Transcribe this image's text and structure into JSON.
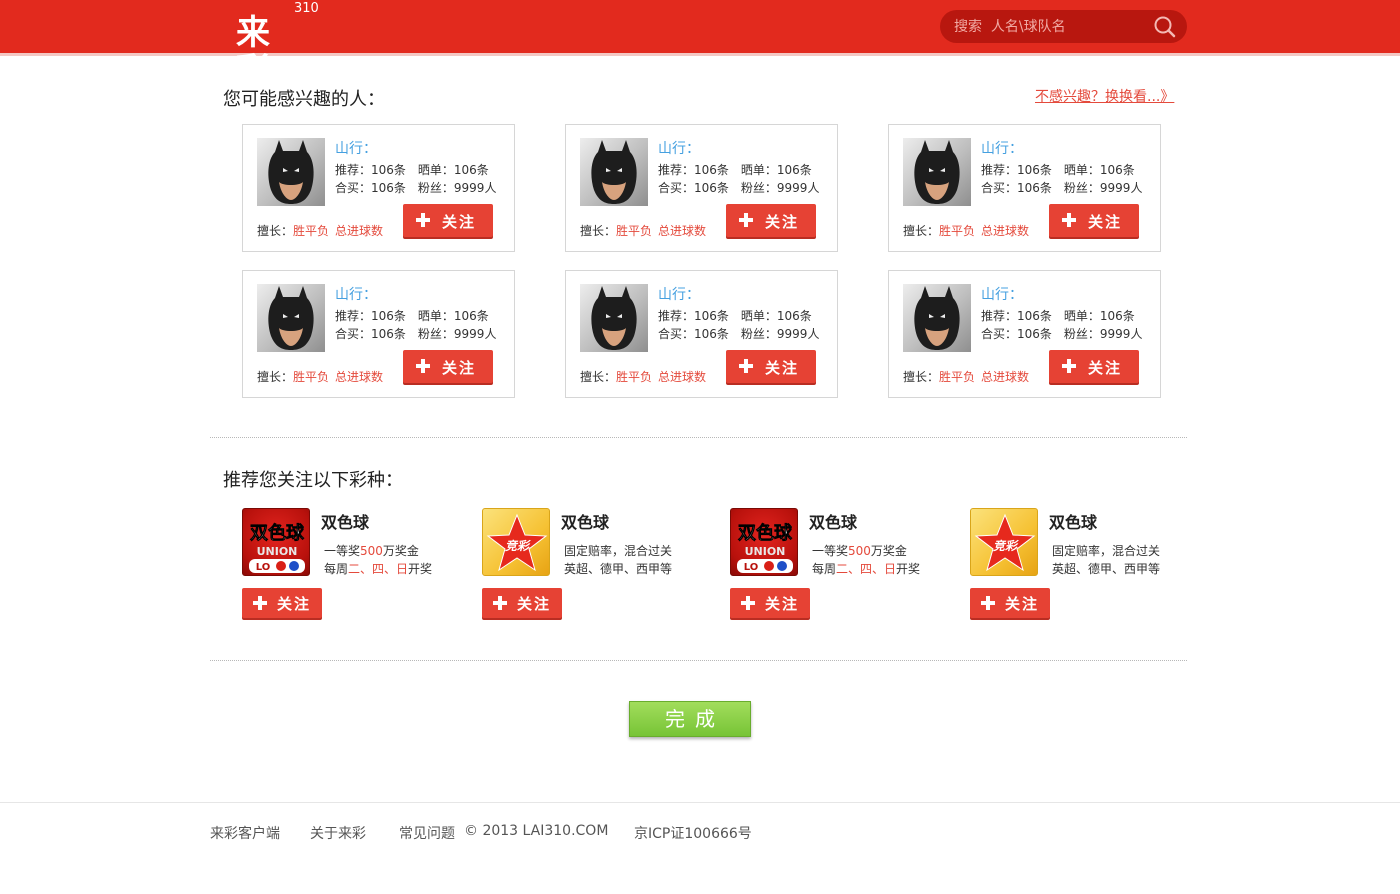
{
  "header": {
    "logo_text": "来彩",
    "logo_number": "310",
    "search_placeholder": "搜索  人名\\球队名"
  },
  "people_section": {
    "title": "您可能感兴趣的人：",
    "change_link": "不感兴趣？换换看...》",
    "cards": [
      {
        "name": "山行：",
        "recommend": "推荐：106条",
        "show": "晒单：106条",
        "joint": "合买：106条",
        "fans": "粉丝：9999人",
        "expert_label": "擅长：",
        "tags": [
          "胜平负",
          "总进球数"
        ],
        "follow": "关注"
      },
      {
        "name": "山行：",
        "recommend": "推荐：106条",
        "show": "晒单：106条",
        "joint": "合买：106条",
        "fans": "粉丝：9999人",
        "expert_label": "擅长：",
        "tags": [
          "胜平负",
          "总进球数"
        ],
        "follow": "关注"
      },
      {
        "name": "山行：",
        "recommend": "推荐：106条",
        "show": "晒单：106条",
        "joint": "合买：106条",
        "fans": "粉丝：9999人",
        "expert_label": "擅长：",
        "tags": [
          "胜平负",
          "总进球数"
        ],
        "follow": "关注"
      },
      {
        "name": "山行：",
        "recommend": "推荐：106条",
        "show": "晒单：106条",
        "joint": "合买：106条",
        "fans": "粉丝：9999人",
        "expert_label": "擅长：",
        "tags": [
          "胜平负",
          "总进球数"
        ],
        "follow": "关注"
      },
      {
        "name": "山行：",
        "recommend": "推荐：106条",
        "show": "晒单：106条",
        "joint": "合买：106条",
        "fans": "粉丝：9999人",
        "expert_label": "擅长：",
        "tags": [
          "胜平负",
          "总进球数"
        ],
        "follow": "关注"
      },
      {
        "name": "山行：",
        "recommend": "推荐：106条",
        "show": "晒单：106条",
        "joint": "合买：106条",
        "fans": "粉丝：9999人",
        "expert_label": "擅长：",
        "tags": [
          "胜平负",
          "总进球数"
        ],
        "follow": "关注"
      }
    ]
  },
  "lottery_section": {
    "title": "推荐您关注以下彩种：",
    "items": [
      {
        "icon": "union-lotto-icon",
        "name": "双色球",
        "line1": [
          "一等奖",
          "500",
          "万奖金"
        ],
        "line2": [
          "每周",
          "二、四、日",
          "开奖"
        ],
        "follow": "关注"
      },
      {
        "icon": "jingcai-star-icon",
        "name": "双色球",
        "line1": [
          "固定赔率，混合过关",
          "",
          ""
        ],
        "line2": [
          "英超、德甲、西甲等",
          "",
          ""
        ],
        "follow": "关注"
      },
      {
        "icon": "union-lotto-icon",
        "name": "双色球",
        "line1": [
          "一等奖",
          "500",
          "万奖金"
        ],
        "line2": [
          "每周",
          "二、四、日",
          "开奖"
        ],
        "follow": "关注"
      },
      {
        "icon": "jingcai-star-icon",
        "name": "双色球",
        "line1": [
          "固定赔率，混合过关",
          "",
          ""
        ],
        "line2": [
          "英超、德甲、西甲等",
          "",
          ""
        ],
        "follow": "关注"
      }
    ],
    "icon_text": {
      "union_cn": "双色球",
      "union_en": "UNION LOTTO",
      "jingcai": "竞彩"
    }
  },
  "done_button": "完成",
  "footer": {
    "client": "来彩客户端",
    "about": "关于来彩",
    "faq": "常见问题",
    "copyright": "© 2013 LAI310.COM",
    "icp": "京ICP证100666号"
  },
  "colors": {
    "brand_red": "#e22a1e",
    "button_red": "#e64234",
    "name_blue": "#45a0e0",
    "done_green": "#8fd24a"
  }
}
